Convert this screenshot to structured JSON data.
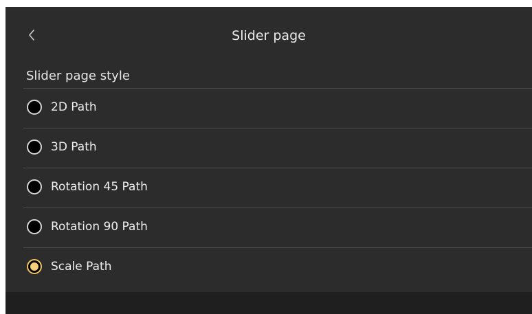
{
  "header": {
    "title": "Slider page",
    "back_icon": "chevron-left-icon"
  },
  "section": {
    "title": "Slider page style"
  },
  "options": [
    {
      "label": "2D Path",
      "selected": false
    },
    {
      "label": "3D Path",
      "selected": false
    },
    {
      "label": "Rotation 45 Path",
      "selected": false
    },
    {
      "label": "Rotation 90 Path",
      "selected": false
    },
    {
      "label": "Scale Path",
      "selected": true
    }
  ],
  "colors": {
    "background": "#2c2c2c",
    "accent": "#f3c462",
    "divider": "#4c4c4c",
    "footer": "#1f1f1f"
  }
}
